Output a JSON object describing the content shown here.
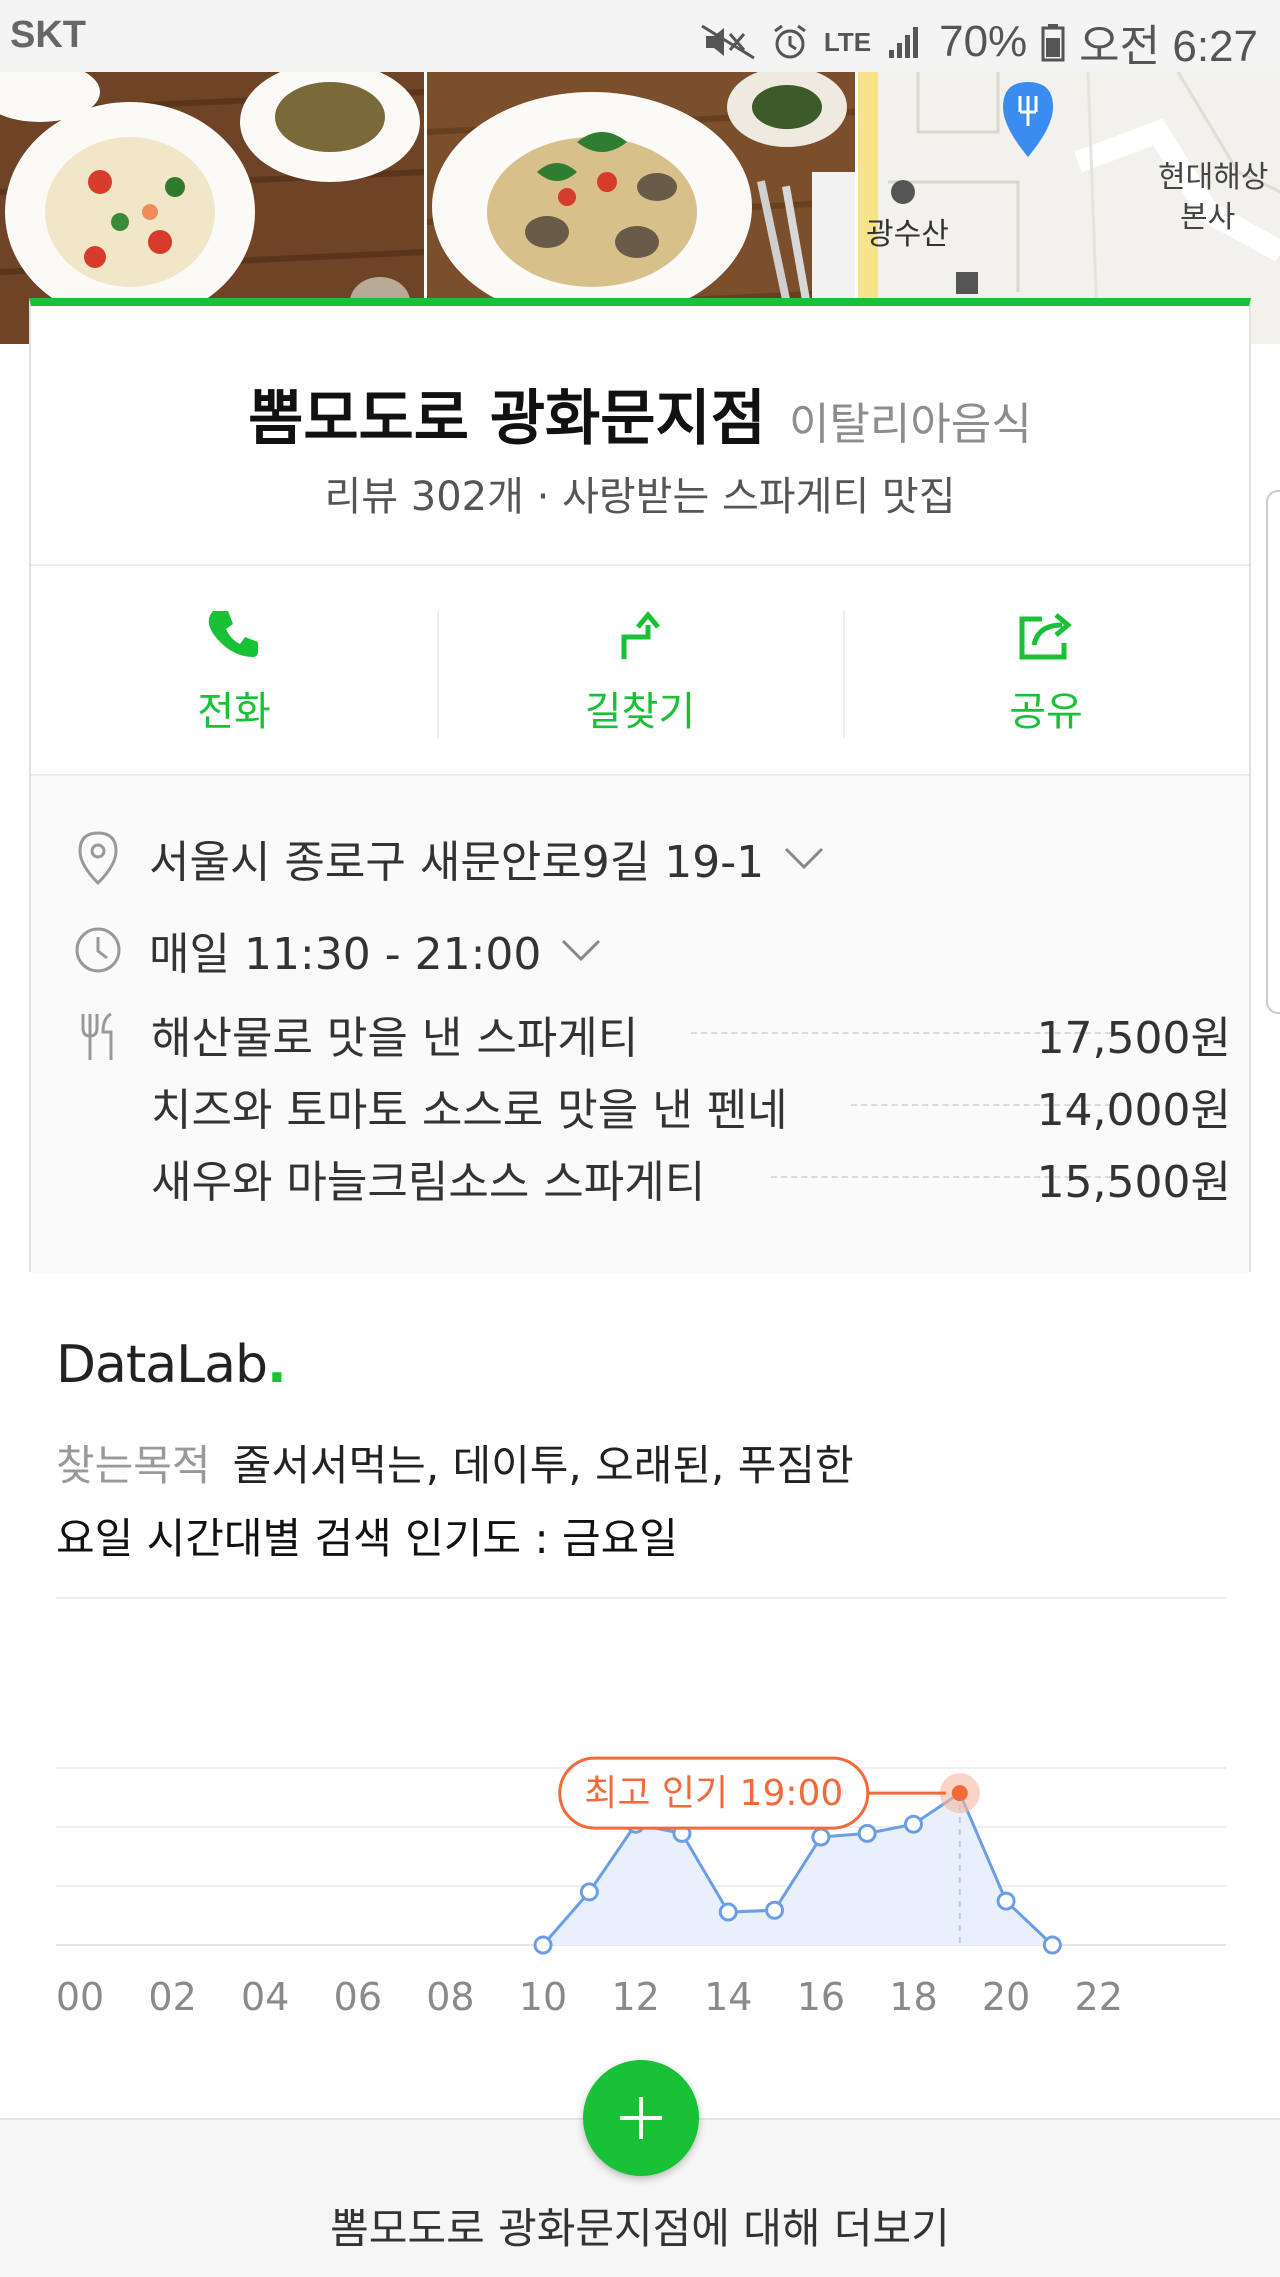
{
  "status_bar": {
    "carrier": "SKT",
    "battery": "70%",
    "time": "오전 6:27",
    "network": "LTE"
  },
  "place": {
    "name": "뽐모도로 광화문지점",
    "category": "이탈리아음식",
    "subtitle": "리뷰 302개 · 사랑받는 스파게티 맛집"
  },
  "actions": [
    {
      "label": "전화",
      "icon": "phone-icon"
    },
    {
      "label": "길찾기",
      "icon": "directions-icon"
    },
    {
      "label": "공유",
      "icon": "share-icon"
    }
  ],
  "details": {
    "address": "서울시 종로구 새문안로9길 19-1",
    "hours": "매일 11:30 - 21:00",
    "menu": [
      {
        "name": "해산물로 맛을 낸 스파게티",
        "price": "17,500원"
      },
      {
        "name": "치즈와 토마토 소스로 맛을 낸 펜네",
        "price": "14,000원"
      },
      {
        "name": "새우와 마늘크림소스 스파게티",
        "price": "15,500원"
      }
    ]
  },
  "map_labels": {
    "poi1": "광수산",
    "poi2_line1": "현대해상",
    "poi2_line2": "본사"
  },
  "datalab": {
    "logo": "DataLab",
    "purpose_label": "찾는목적",
    "purpose_values": "줄서서먹는, 데이투, 오래된, 푸짐한",
    "popularity_title": "요일 시간대별 검색 인기도 : 금요일"
  },
  "chart_data": {
    "type": "area",
    "x": [
      10,
      11,
      12,
      13,
      14,
      15,
      16,
      17,
      18,
      19,
      20,
      21
    ],
    "values": [
      0,
      29,
      66,
      61,
      18,
      19,
      59,
      61,
      66,
      83,
      24,
      0
    ],
    "xlim": [
      0,
      23
    ],
    "ylim": [
      0,
      100
    ],
    "tick_labels": [
      "00",
      "02",
      "04",
      "06",
      "08",
      "10",
      "12",
      "14",
      "16",
      "18",
      "20",
      "22"
    ],
    "peak_label": "최고 인기 19:00",
    "peak_x": 19,
    "grid": true,
    "colors": {
      "line": "#6a9ee6",
      "fill": "#e9f0fb",
      "peak": "#f26a3a"
    }
  },
  "footer": {
    "more_text": "뽐모도로 광화문지점에 대해 더보기"
  },
  "colors": {
    "accent": "#19c137"
  }
}
